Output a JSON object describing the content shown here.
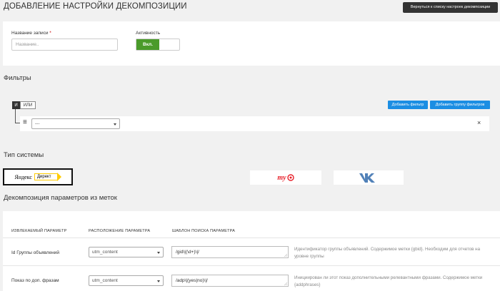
{
  "header": {
    "title": "ДОБАВЛЕНИЕ НАСТРОЙКИ ДЕКОМПОЗИЦИИ",
    "back_label": "Вернуться к списку настроек декомпозиции"
  },
  "record": {
    "name_label": "Название записи",
    "required_mark": "*",
    "name_placeholder": "Название..",
    "active_label": "Активность",
    "active_on_label": "Вкл."
  },
  "filters": {
    "title": "Фильтры",
    "and_label": "И",
    "or_label": "ИЛИ",
    "add_filter_label": "Добавить фильтр",
    "add_group_label": "Добавить группу фильтров",
    "row_select_value": "---",
    "remove_glyph": "×",
    "drag_glyph": "≡"
  },
  "system": {
    "title": "Тип системы",
    "yandex_word": "Яндекс",
    "direct_word": "Директ",
    "mytarget_word": "my"
  },
  "decomposition": {
    "title": "Декомпозиция параметров из меток",
    "columns": [
      "ИЗВЛЕКАЕМЫЙ ПАРАМЕТР",
      "РАСПОЛОЖЕНИЕ ПАРАМЕТРА",
      "ШАБЛОН ПОИСКА ПАРАМЕТРА"
    ],
    "rows": [
      {
        "param": "Id Группы объявлений",
        "location": "utm_content",
        "pattern": "/gid\\|(\\d+)\\|/",
        "description": "Идентификатор группы объявлений. Содержимое метки {gbid}. Необходим для отчетов на уровне группы"
      },
      {
        "param": "Показ по доп. фразам",
        "location": "utm_content",
        "pattern": "/adp\\|(yes|no)\\|/",
        "description": "Инициирован ли этот показ дополнительными релевантными фразами. Содержимое метки {addphrases}"
      }
    ]
  },
  "colors": {
    "accent": "#1b8ee3",
    "active_green": "#4a9b2a",
    "vk_blue": "#5181b8",
    "mytarget_red": "#e8202a",
    "yandex_yellow": "#ffcc00"
  }
}
